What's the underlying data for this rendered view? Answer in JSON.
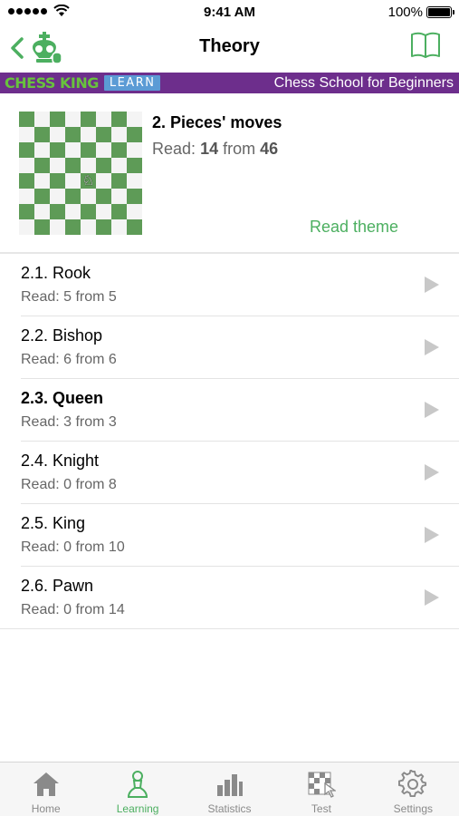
{
  "status_bar": {
    "time": "9:41 AM",
    "battery": "100%"
  },
  "nav": {
    "title": "Theory"
  },
  "banner": {
    "brand": "CHESS KING",
    "badge": "LEARN",
    "subtitle": "Chess School for Beginners"
  },
  "theme": {
    "title": "2. Pieces' moves",
    "read_prefix": "Read:",
    "read_count": "14",
    "read_from": "from",
    "read_total": "46",
    "action": "Read theme"
  },
  "lessons": [
    {
      "title": "2.1. Rook",
      "status": "Read: 5 from 5"
    },
    {
      "title": "2.2. Bishop",
      "status": "Read: 6 from 6"
    },
    {
      "title": "2.3. Queen",
      "status": "Read: 3 from 3"
    },
    {
      "title": "2.4. Knight",
      "status": "Read: 0 from 8"
    },
    {
      "title": "2.5. King",
      "status": "Read: 0 from 10"
    },
    {
      "title": "2.6. Pawn",
      "status": "Read: 0 from 14"
    }
  ],
  "tabs": [
    {
      "label": "Home",
      "icon": "home-icon"
    },
    {
      "label": "Learning",
      "icon": "pawn-icon"
    },
    {
      "label": "Statistics",
      "icon": "bar-chart-icon"
    },
    {
      "label": "Test",
      "icon": "board-hand-icon"
    },
    {
      "label": "Settings",
      "icon": "gear-icon"
    }
  ],
  "colors": {
    "accent": "#4caf60",
    "banner": "#6d2e8c",
    "board_dark": "#5e9b57"
  }
}
